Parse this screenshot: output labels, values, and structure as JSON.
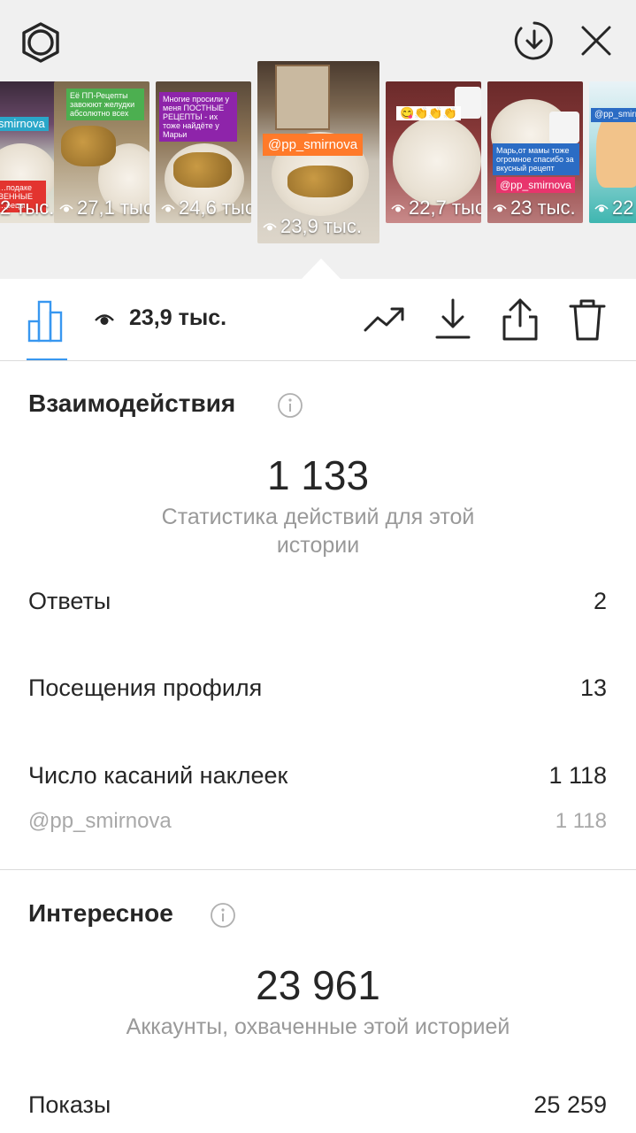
{
  "header": {
    "settings_icon": "gear-icon",
    "download_icon": "download-circle-icon",
    "close_icon": "close-icon"
  },
  "stories": [
    {
      "views": "2 тыс.",
      "handle": "smirnova",
      "caption": "…подаке ВЕННЫЕ …рецы"
    },
    {
      "views": "27,1 тыс.",
      "caption": "Её ПП-Рецепты завоюют желудки абсолютно всех"
    },
    {
      "views": "24,6 тыс.",
      "caption": "Многие просили у меня ПОСТНЫЕ РЕЦЕПТЫ - их тоже найдёте у Марьи"
    },
    {
      "views": "23,9 тыс.",
      "handle": "@pp_smirnova"
    },
    {
      "views": "22,7 тыс.",
      "caption": "😋👏👏👏"
    },
    {
      "views": "23 тыс.",
      "handle": "@pp_smirnova",
      "caption": "Марь,от мамы тоже огромное спасибо за вкусный рецепт"
    },
    {
      "views": "22",
      "handle": "@pp_smirnova"
    }
  ],
  "toolbar": {
    "views": "23,9 тыс.",
    "icons": [
      "bar-chart-icon",
      "eye-icon",
      "trending-icon",
      "download-icon",
      "share-icon",
      "trash-icon"
    ]
  },
  "interactions": {
    "title": "Взаимодействия",
    "total": "1 133",
    "caption": "Статистика действий для этой истории",
    "rows": [
      {
        "label": "Ответы",
        "value": "2"
      },
      {
        "label": "Посещения профиля",
        "value": "13"
      },
      {
        "label": "Число касаний наклеек",
        "value": "1 118"
      }
    ],
    "sub": {
      "label": "@pp_smirnova",
      "value": "1 118"
    }
  },
  "discovery": {
    "title": "Интересное",
    "total": "23 961",
    "caption": "Аккаунты, охваченные этой историей",
    "rows": [
      {
        "label": "Показы",
        "value": "25 259"
      }
    ]
  },
  "colors": {
    "accent": "#3897f0",
    "handle_tag": "#ff7a2a",
    "muted": "#999999"
  }
}
